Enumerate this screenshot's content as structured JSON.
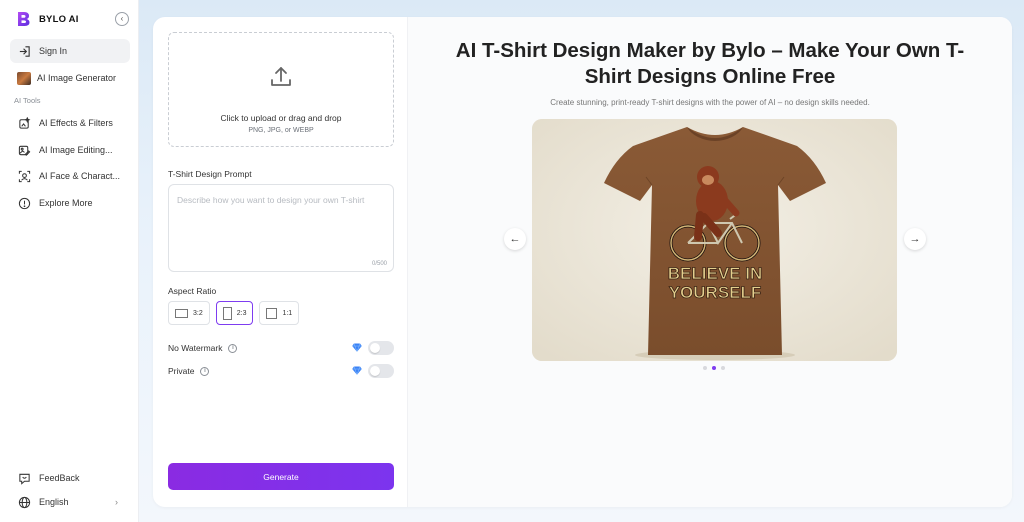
{
  "app": {
    "name": "BYLO AI",
    "brand_color": "#7e3cf0"
  },
  "sidebar": {
    "sign_in": "Sign In",
    "image_generator": "AI Image Generator",
    "section_label": "AI Tools",
    "items": [
      {
        "label": "AI Effects & Filters",
        "icon": "effects-icon"
      },
      {
        "label": "AI Image Editing...",
        "icon": "image-edit-icon"
      },
      {
        "label": "AI Face & Charact...",
        "icon": "face-icon"
      },
      {
        "label": "Explore More",
        "icon": "explore-icon"
      }
    ],
    "feedback": "FeedBack",
    "language": "English"
  },
  "upload": {
    "title": "Click to upload or drag and drop",
    "formats": "PNG, JPG, or WEBP"
  },
  "prompt": {
    "label": "T-Shirt Design Prompt",
    "placeholder": "Describe how you want to design your own T-shirt",
    "counter": "0/500"
  },
  "aspect_ratio": {
    "label": "Aspect Ratio",
    "options": [
      "3:2",
      "2:3",
      "1:1"
    ],
    "selected": "2:3"
  },
  "options": {
    "no_watermark": "No Watermark",
    "private": "Private",
    "no_watermark_on": false,
    "private_on": false
  },
  "generate_label": "Generate",
  "hero": {
    "title": "AI T-Shirt Design Maker by Bylo – Make Your Own T-Shirt Designs Online Free",
    "subtitle": "Create stunning, print-ready T-shirt designs with the power of AI – no design skills needed.",
    "shirt_text_line1": "BELIEVE IN",
    "shirt_text_line2": "YOURSELF",
    "prev_arrow": "←",
    "next_arrow": "→",
    "slide_count": 3,
    "active_slide": 2
  }
}
